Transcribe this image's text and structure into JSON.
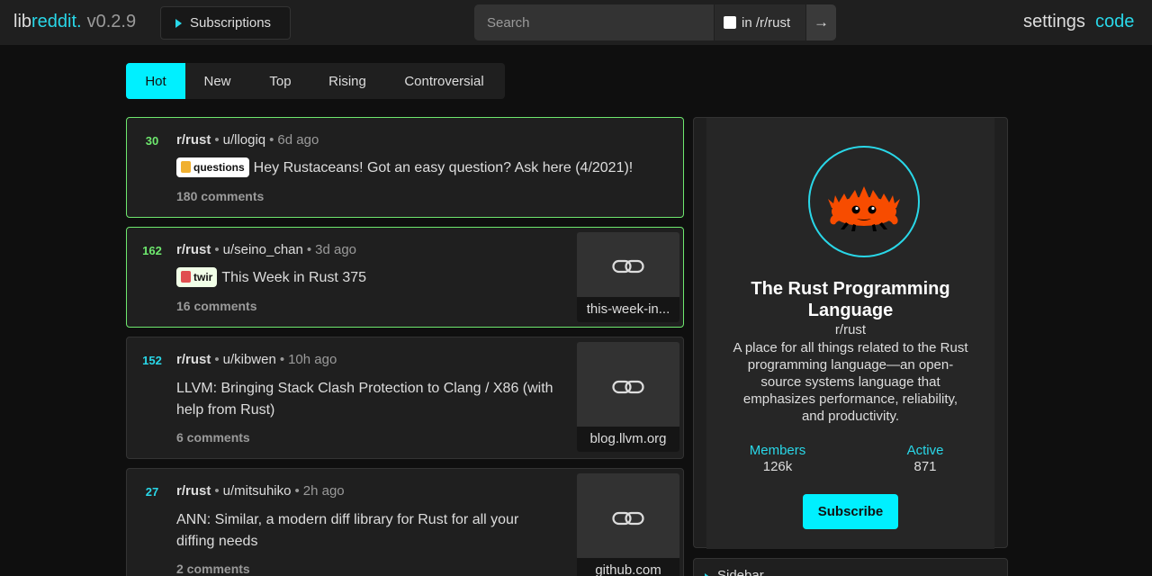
{
  "header": {
    "logo_lib": "lib",
    "logo_reddit": "reddit.",
    "version": "v0.2.9",
    "subscriptions_label": "Subscriptions",
    "search_placeholder": "Search",
    "restrict_label": "in /r/rust",
    "go_label": "→",
    "settings_label": "settings",
    "code_label": "code"
  },
  "sort_tabs": [
    {
      "label": "Hot",
      "active": true
    },
    {
      "label": "New",
      "active": false
    },
    {
      "label": "Top",
      "active": false
    },
    {
      "label": "Rising",
      "active": false
    },
    {
      "label": "Controversial",
      "active": false
    }
  ],
  "posts": [
    {
      "score": "30",
      "subreddit": "r/rust",
      "author": "u/llogiq",
      "time": "6d ago",
      "flair": "questions",
      "flair_icon": "crab-emoji",
      "title": "Hey Rustaceans! Got an easy question? Ask here (4/2021)!",
      "comments": "180 comments",
      "highlighted": true
    },
    {
      "score": "162",
      "subreddit": "r/rust",
      "author": "u/seino_chan",
      "time": "3d ago",
      "flair": "twir",
      "flair_icon": "calendar-emoji",
      "title": "This Week in Rust 375",
      "comments": "16 comments",
      "thumb_domain": "this-week-in...",
      "highlighted": true
    },
    {
      "score": "152",
      "subreddit": "r/rust",
      "author": "u/kibwen",
      "time": "10h ago",
      "title": "LLVM: Bringing Stack Clash Protection to Clang / X86 (with help from Rust)",
      "comments": "6 comments",
      "thumb_domain": "blog.llvm.org",
      "highlighted": false
    },
    {
      "score": "27",
      "subreddit": "r/rust",
      "author": "u/mitsuhiko",
      "time": "2h ago",
      "title": "ANN: Similar, a modern diff library for Rust for all your diffing needs",
      "comments": "2 comments",
      "thumb_domain": "github.com",
      "highlighted": false
    }
  ],
  "sidebar": {
    "title": "The Rust Programming Language",
    "name": "r/rust",
    "description": "A place for all things related to the Rust programming language—an open-source systems language that emphasizes performance, reliability, and productivity.",
    "members_label": "Members",
    "members_value": "126k",
    "active_label": "Active",
    "active_value": "871",
    "subscribe_label": "Subscribe",
    "toggle_label": "Sidebar",
    "avatar_icon": "ferris-crab-icon"
  },
  "colors": {
    "accent": "#29d7e8",
    "button_bg": "#00f0ff",
    "highlight_border": "#6ee86e",
    "background": "#0f0f0f",
    "panel": "#1f1f1f"
  }
}
